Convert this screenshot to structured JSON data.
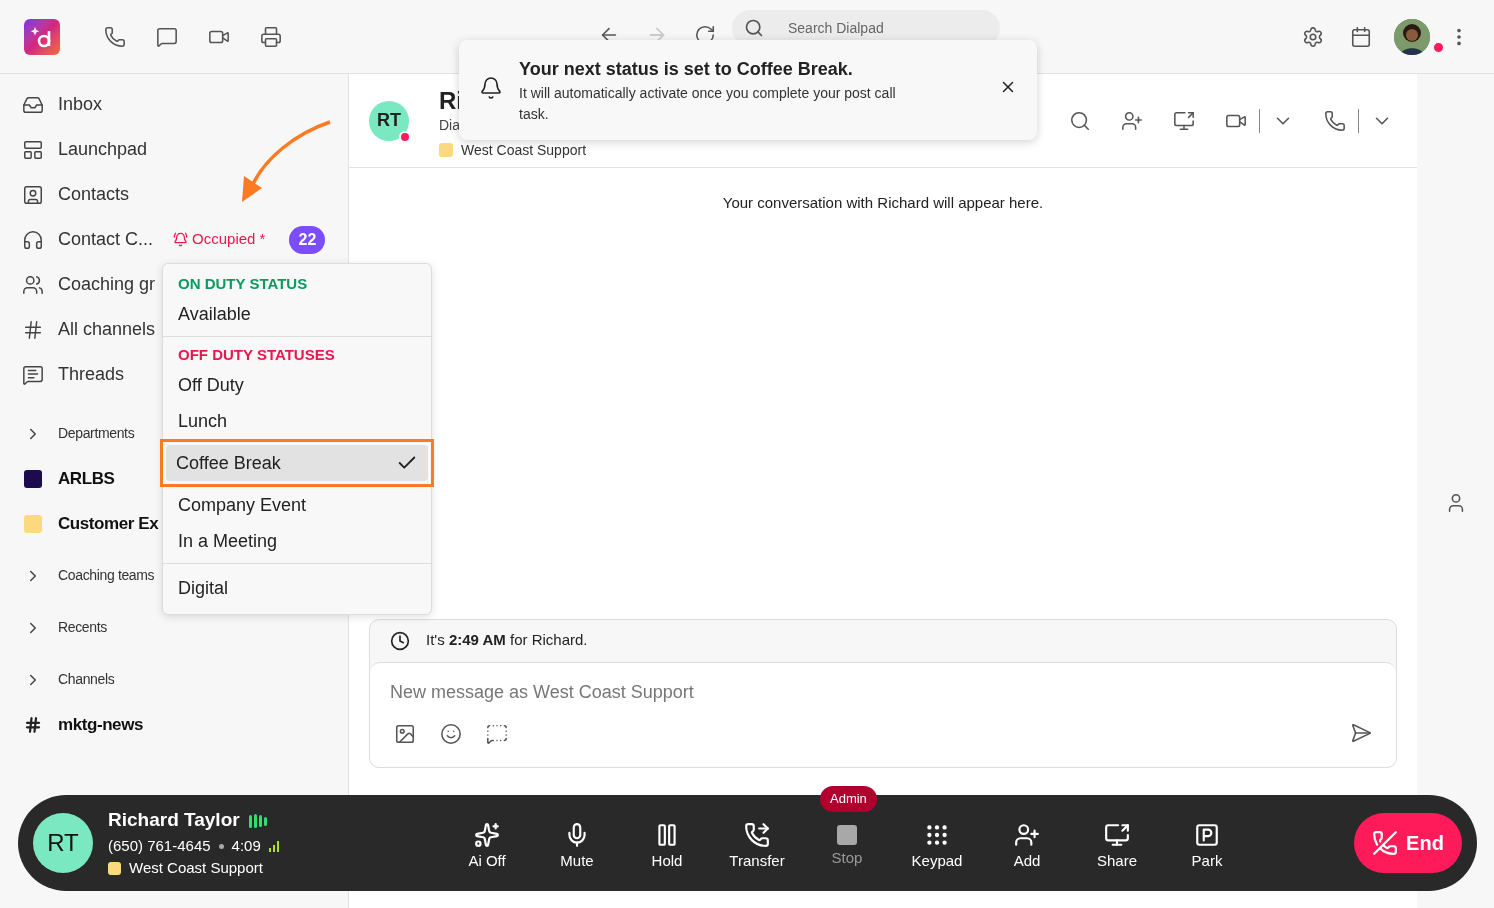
{
  "topbar": {
    "search": {
      "placeholder": "Search Dialpad"
    }
  },
  "sidebar": {
    "items": [
      {
        "label": "Inbox"
      },
      {
        "label": "Launchpad"
      },
      {
        "label": "Contacts"
      },
      {
        "label": "Contact C...",
        "status": "Occupied *",
        "count": "22"
      },
      {
        "label": "Coaching gr"
      },
      {
        "label": "All channels"
      },
      {
        "label": "Threads"
      }
    ],
    "sections": [
      {
        "kind": "header",
        "label": "Departments"
      },
      {
        "kind": "group",
        "label": "ARLBS",
        "color": "#1e0a4f"
      },
      {
        "kind": "group",
        "label": "Customer Ex",
        "color": "#fcd97e"
      },
      {
        "kind": "header",
        "label": "Coaching teams"
      },
      {
        "kind": "header",
        "label": "Recents"
      },
      {
        "kind": "header",
        "label": "Channels"
      },
      {
        "kind": "channel",
        "label": "mktg-news"
      }
    ]
  },
  "status_menu": {
    "sections": [
      {
        "header": "ON DUTY STATUS",
        "color": "#0a9b5e",
        "items": [
          {
            "label": "Available",
            "selected": false
          }
        ]
      },
      {
        "header": "OFF DUTY STATUSES",
        "color": "#e8174d",
        "items": [
          {
            "label": "Off Duty",
            "selected": false
          },
          {
            "label": "Lunch",
            "selected": false
          },
          {
            "label": "Coffee Break",
            "selected": true
          },
          {
            "label": "Company Event",
            "selected": false
          },
          {
            "label": "In a Meeting",
            "selected": false
          }
        ]
      },
      {
        "items": [
          {
            "label": "Digital",
            "selected": false
          }
        ]
      }
    ]
  },
  "toast": {
    "title": "Your next status is set to Coffee Break.",
    "body": "It will automatically activate once you complete your post call task."
  },
  "conversation": {
    "avatar": "RT",
    "name": "Ri",
    "subtitle": "Dia",
    "tag": "West Coast Support",
    "empty_text": "Your conversation with Richard will appear here.",
    "local_time": "It's **2:49 AM** for Richard.",
    "composer": {
      "placeholder": "New message as West Coast Support"
    }
  },
  "call_bar": {
    "avatar": "RT",
    "name": "Richard Taylor",
    "phone": "(650) 761-4645",
    "duration": "4:09",
    "queue": "West Coast Support",
    "actions": [
      {
        "label": "Ai Off",
        "disabled": false
      },
      {
        "label": "Mute",
        "disabled": false
      },
      {
        "label": "Hold",
        "disabled": false
      },
      {
        "label": "Transfer",
        "disabled": false
      },
      {
        "label": "Stop",
        "disabled": true,
        "badge": "Admin"
      },
      {
        "label": "Keypad",
        "disabled": false
      },
      {
        "label": "Add",
        "disabled": false
      },
      {
        "label": "Share",
        "disabled": false
      },
      {
        "label": "Park",
        "disabled": false
      }
    ],
    "end_label": "End"
  }
}
